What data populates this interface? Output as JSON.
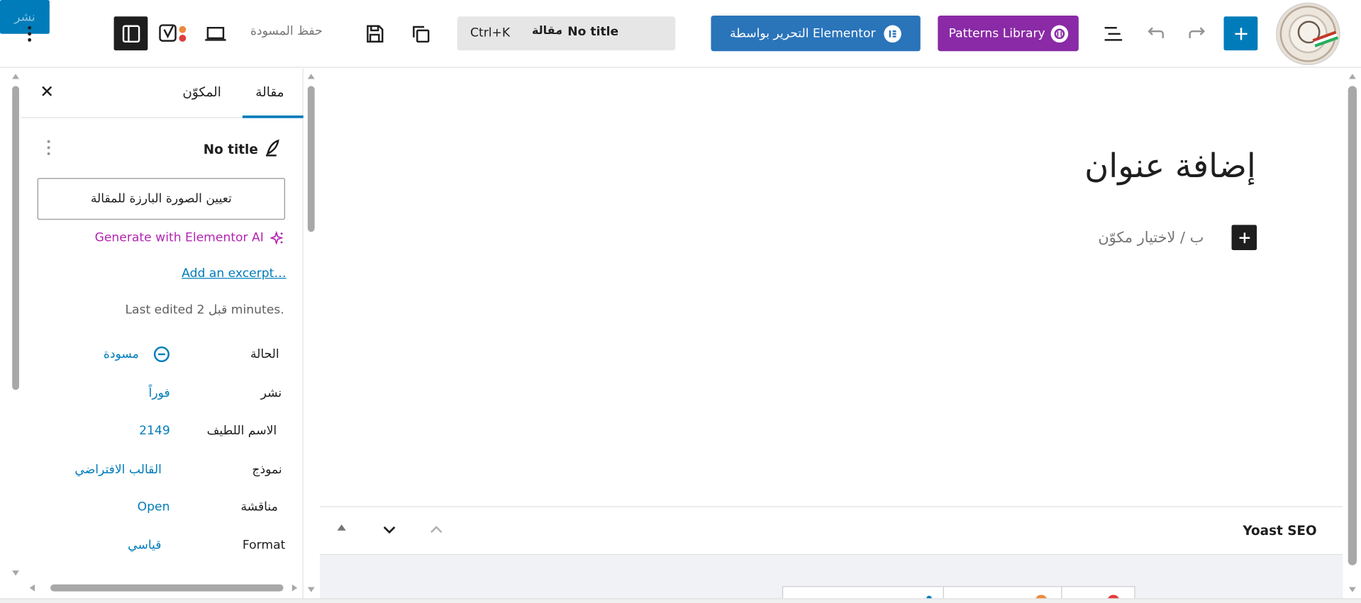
{
  "topbar": {
    "publish_label": "نشر",
    "save_draft_label": "حفظ المسودة",
    "command": {
      "shortcut": "Ctrl+K",
      "post_type": "مقالة",
      "separator": "·",
      "title": "No title"
    },
    "elementor_label": "التحرير بواسطة Elementor",
    "patterns_label": "Patterns Library",
    "icons": {
      "options": "more-vertical-icon",
      "settings": "sidebar-toggle-icon",
      "yoast": "yoast-icon",
      "preview": "laptop-preview-icon",
      "save": "save-icon",
      "copy": "copy-icon",
      "document_overview": "list-view-icon",
      "undo": "undo-icon",
      "redo": "redo-icon",
      "add": "plus-icon"
    }
  },
  "sidebar": {
    "tabs": [
      {
        "label": "مقالة",
        "active": true
      },
      {
        "label": "المكوّن",
        "active": false
      }
    ],
    "post_title": "No title",
    "featured_image_label": "تعيين الصورة البارزة للمقالة",
    "generate_ai_label": "Generate with Elementor AI",
    "excerpt_link": "Add an excerpt…",
    "last_edited": "Last edited قبل 2 minutes.",
    "rows": [
      {
        "label": "الحالة",
        "value": "مسودة"
      },
      {
        "label": "نشر",
        "value": "فوراً"
      },
      {
        "label": "الاسم اللطيف",
        "value": "2149"
      },
      {
        "label": "نموذج",
        "value": "القالب الافتراضي"
      },
      {
        "label": "مناقشة",
        "value": "Open"
      },
      {
        "label": "Format",
        "value": "قياسي"
      }
    ]
  },
  "canvas": {
    "title_placeholder": "إضافة عنوان",
    "appender_placeholder": "ب / لاختيار مكوّن"
  },
  "metabox": {
    "title": "Yoast SEO"
  },
  "colors": {
    "primary": "#007cba",
    "elementor": "#2a74ba",
    "patterns": "#8a2aa6",
    "ai": "#b325b3"
  }
}
